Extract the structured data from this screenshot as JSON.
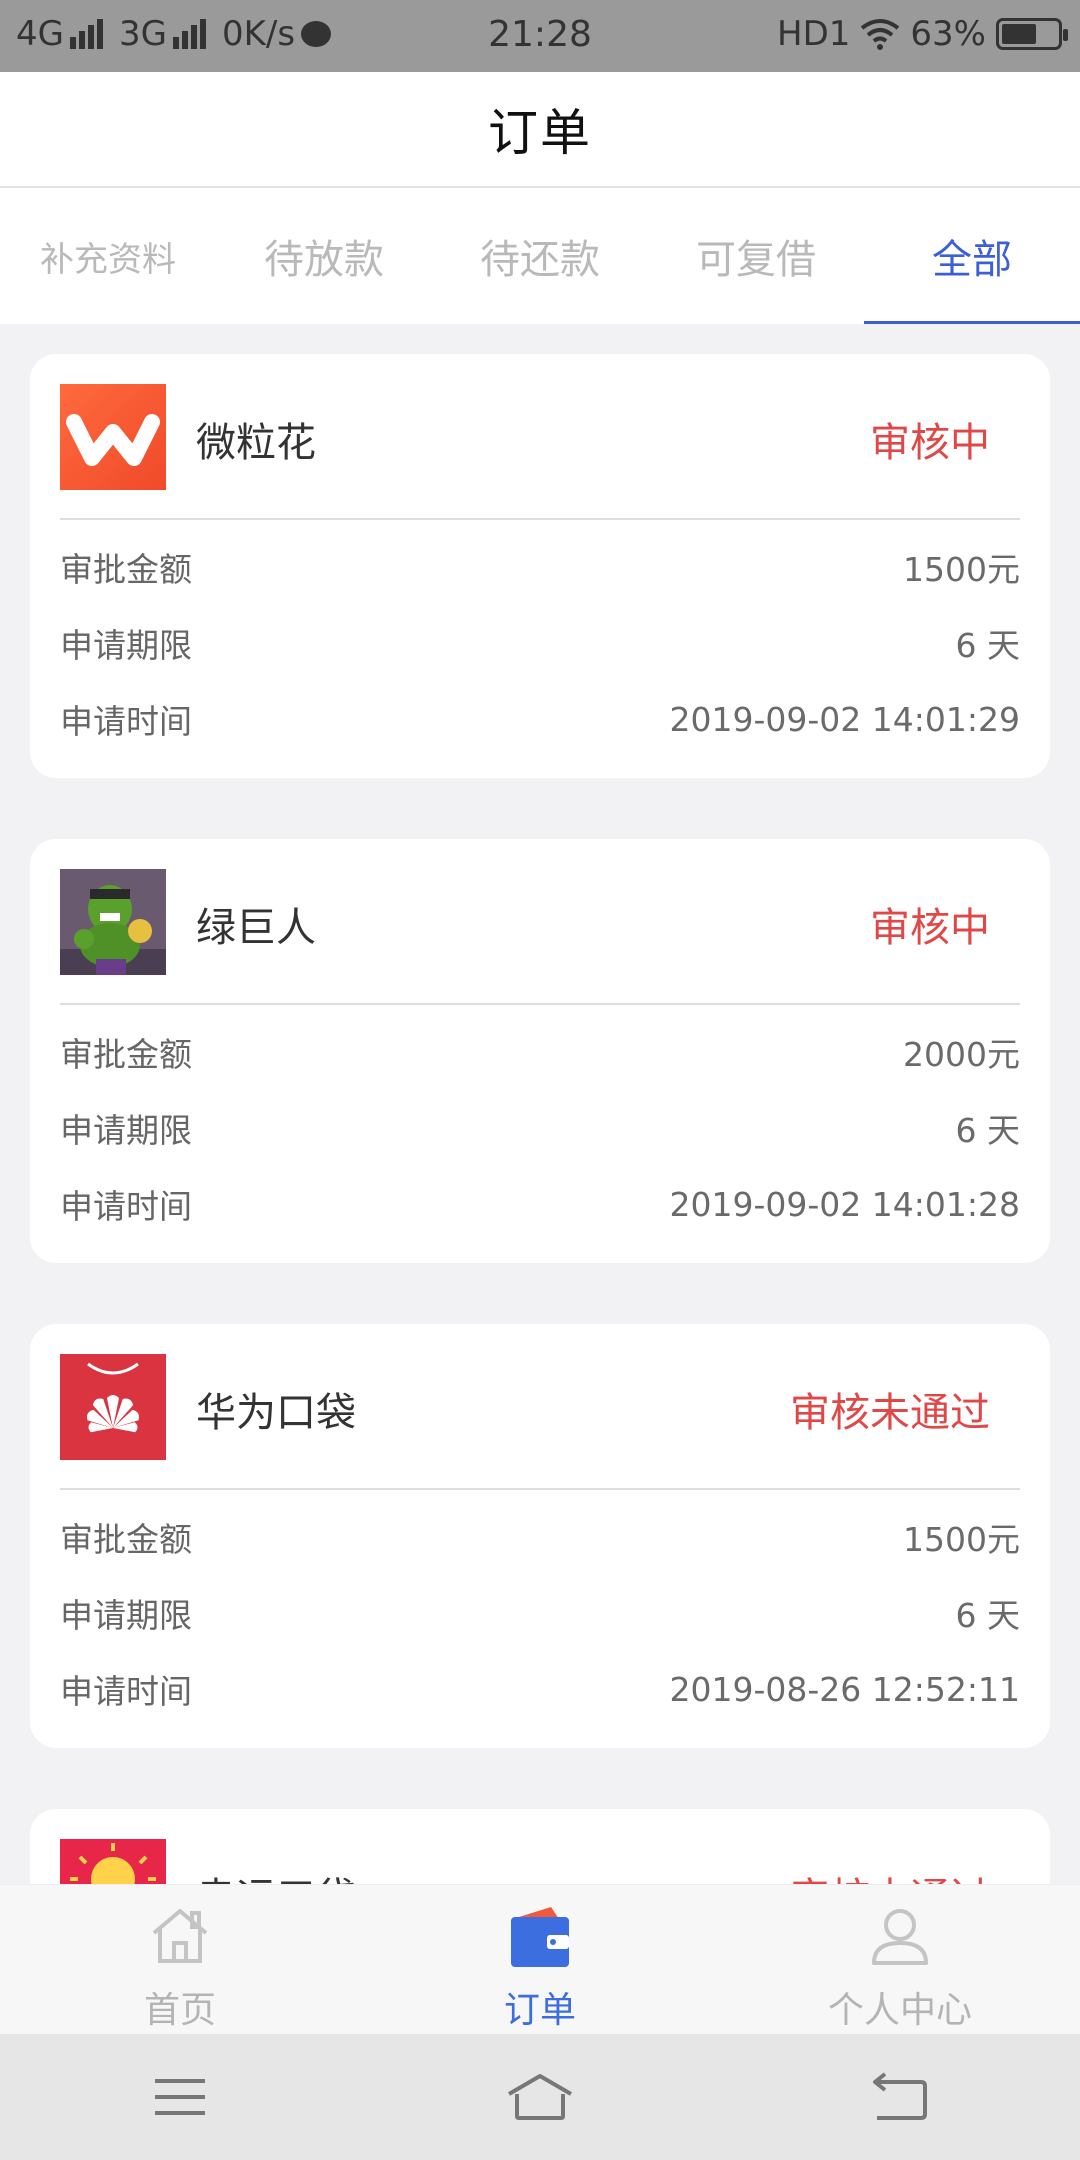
{
  "status_bar": {
    "network1": "4G",
    "network2": "3G",
    "speed": "0K/s",
    "time": "21:28",
    "hd": "HD1",
    "battery": "63%",
    "battery_level": 0.63
  },
  "header": {
    "title": "订单"
  },
  "tabs": [
    {
      "label": "补充资料",
      "active": false
    },
    {
      "label": "待放款",
      "active": false
    },
    {
      "label": "待还款",
      "active": false
    },
    {
      "label": "可复借",
      "active": false
    },
    {
      "label": "全部",
      "active": true
    }
  ],
  "orders": [
    {
      "name": "微粒花",
      "status": "审核中",
      "logo": "w-logo-icon",
      "rows": [
        {
          "label": "审批金额",
          "value": "1500元"
        },
        {
          "label": "申请期限",
          "value": "6 天"
        },
        {
          "label": "申请时间",
          "value": "2019-09-02 14:01:29"
        }
      ]
    },
    {
      "name": "绿巨人",
      "status": "审核中",
      "logo": "hulk-avatar-icon",
      "rows": [
        {
          "label": "审批金额",
          "value": "2000元"
        },
        {
          "label": "申请期限",
          "value": "6 天"
        },
        {
          "label": "申请时间",
          "value": "2019-09-02 14:01:28"
        }
      ]
    },
    {
      "name": "华为口袋",
      "status": "审核未通过",
      "logo": "huawei-bag-icon",
      "rows": [
        {
          "label": "审批金额",
          "value": "1500元"
        },
        {
          "label": "申请期限",
          "value": "6 天"
        },
        {
          "label": "申请时间",
          "value": "2019-08-26 12:52:11"
        }
      ]
    },
    {
      "name": "幸运口袋",
      "status": "审核未通过",
      "logo": "sun-logo-icon"
    }
  ],
  "bottom_nav": [
    {
      "label": "首页",
      "icon": "home-icon",
      "active": false
    },
    {
      "label": "订单",
      "icon": "wallet-icon",
      "active": true
    },
    {
      "label": "个人中心",
      "icon": "user-icon",
      "active": false
    }
  ],
  "colors": {
    "accent": "#3d5fd6",
    "status_red": "#e04848",
    "background": "#f2f2f5"
  }
}
